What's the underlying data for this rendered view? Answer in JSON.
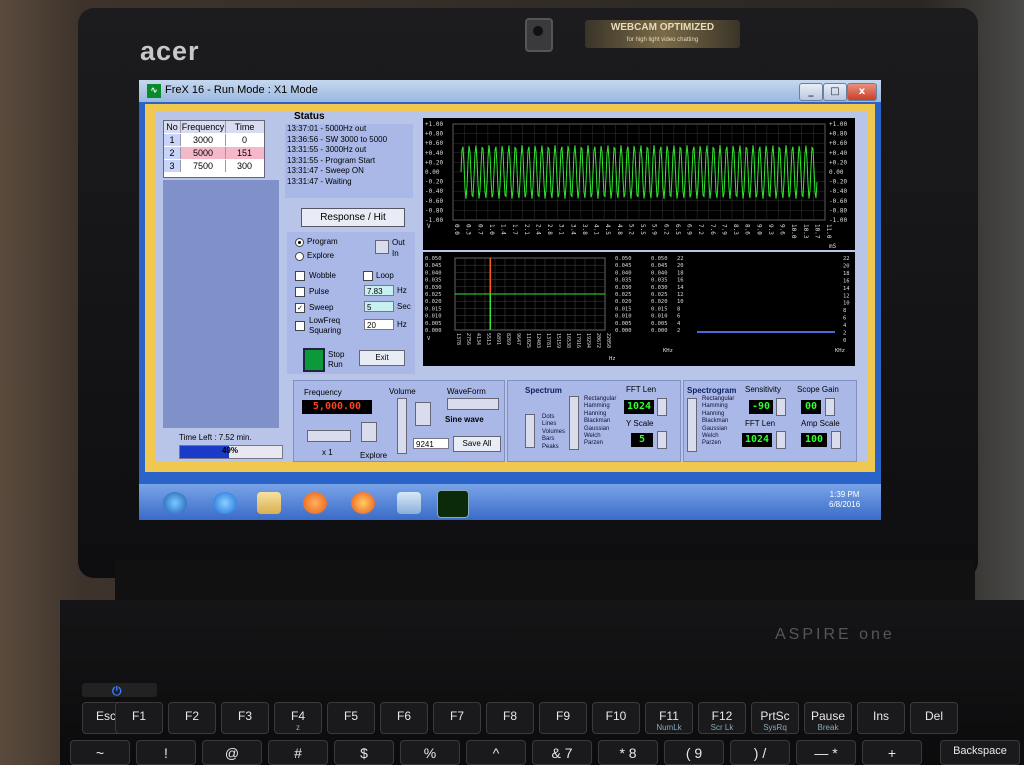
{
  "laptop": {
    "brand": "acer",
    "webcam_sticker": "WEBCAM OPTIMIZED",
    "webcam_sticker_sub": "for high light video chatting",
    "model": "ASPIRE one"
  },
  "keyboard": {
    "row1": [
      {
        "label": "Esc",
        "sub": ""
      },
      {
        "label": "F1",
        "sub": ""
      },
      {
        "label": "F2",
        "sub": ""
      },
      {
        "label": "F3",
        "sub": ""
      },
      {
        "label": "F4",
        "sub": "z"
      },
      {
        "label": "F5",
        "sub": ""
      },
      {
        "label": "F6",
        "sub": ""
      },
      {
        "label": "F7",
        "sub": ""
      },
      {
        "label": "F8",
        "sub": ""
      },
      {
        "label": "F9",
        "sub": ""
      },
      {
        "label": "F10",
        "sub": ""
      },
      {
        "label": "F11",
        "sub": "NumLk"
      },
      {
        "label": "F12",
        "sub": "Scr Lk"
      },
      {
        "label": "PrtSc",
        "sub": "SysRq"
      },
      {
        "label": "Pause",
        "sub": "Break"
      },
      {
        "label": "Ins",
        "sub": ""
      },
      {
        "label": "Del",
        "sub": ""
      }
    ],
    "row2": [
      "~",
      "!",
      "@",
      "#",
      "$",
      "%",
      "^",
      "&  7",
      "*  8",
      "(  9",
      ")  /",
      "—  *",
      "+",
      "Backspace"
    ]
  },
  "window": {
    "title": "FreX 16 - Run Mode :  X1 Mode",
    "icon": "waveform-app-icon",
    "controls": [
      "_",
      "□",
      "x"
    ]
  },
  "freq_table": {
    "headers": [
      "No",
      "Frequency",
      "Time"
    ],
    "rows": [
      {
        "no": "1",
        "frequency": "3000",
        "time": "0",
        "highlight": false
      },
      {
        "no": "2",
        "frequency": "5000",
        "time": "151",
        "highlight": true
      },
      {
        "no": "3",
        "frequency": "7500",
        "time": "300",
        "highlight": false
      }
    ]
  },
  "time_left": "Time Left : 7.52 min.",
  "progress": {
    "value": 0.49,
    "label": "49%"
  },
  "status": {
    "title": "Status",
    "lines": [
      "13:37:01 -  5000Hz out",
      "13:36:56 - SW  3000 to 5000",
      "13:31:55 -  3000Hz out",
      "13:31:55 - Program Start",
      "13:31:47 - Sweep ON",
      "13:31:47 - Waiting"
    ]
  },
  "response_button": "Response / Hit",
  "mode": {
    "program": "Program",
    "explore": "Explore",
    "out": "Out",
    "in": "In",
    "selected": "Program"
  },
  "options": {
    "wobble": {
      "label": "Wobble",
      "checked": false
    },
    "loop": {
      "label": "Loop",
      "checked": false
    },
    "pulse": {
      "label": "Pulse",
      "checked": false,
      "value": "7.83",
      "unit": "Hz"
    },
    "sweep": {
      "label": "Sweep",
      "checked": true,
      "value": "5",
      "unit": "Sec"
    },
    "lowfreq": {
      "label": "LowFreq",
      "label2": "Squaring",
      "checked": false,
      "value": "20",
      "unit": "Hz"
    }
  },
  "stop_run": {
    "stop": "Stop",
    "run": "Run"
  },
  "exit_button": "Exit",
  "scope_top": {
    "y_ticks": [
      "+1.00",
      "+0.80",
      "+0.60",
      "+0.40",
      "+0.20",
      "0.00",
      "-0.20",
      "-0.40",
      "-0.60",
      "-0.80",
      "-1.00"
    ],
    "x_ticks": [
      "0.0",
      "0.3",
      "0.7",
      "1.0",
      "1.4",
      "1.7",
      "2.1",
      "2.4",
      "2.8",
      "3.1",
      "3.4",
      "3.8",
      "4.1",
      "4.5",
      "4.8",
      "5.2",
      "5.5",
      "5.9",
      "6.2",
      "6.5",
      "6.9",
      "7.2",
      "7.6",
      "7.9",
      "8.3",
      "8.6",
      "9.0",
      "9.3",
      "9.6",
      "10.0",
      "10.3",
      "10.7",
      "11.0"
    ],
    "x_unit": "mS",
    "y_unit": "V",
    "trace_color": "#30e830"
  },
  "spectrum_plot": {
    "y_ticks": [
      "0.050",
      "0.045",
      "0.040",
      "0.035",
      "0.030",
      "0.025",
      "0.020",
      "0.015",
      "0.010",
      "0.005",
      "0.000"
    ],
    "x_ticks": [
      "1378",
      "2756",
      "4134",
      "5513",
      "6891",
      "8269",
      "9647",
      "11025",
      "12403",
      "13781",
      "15159",
      "16538",
      "17916",
      "19294",
      "20672",
      "22050"
    ],
    "x_unit": "Hz",
    "y_unit": "V"
  },
  "spectrogram_plot": {
    "left_ticks": [
      "0.050",
      "0.045",
      "0.040",
      "0.035",
      "0.030",
      "0.025",
      "0.020",
      "0.015",
      "0.010",
      "0.005",
      "0.000"
    ],
    "mid_ticks": [
      "22",
      "20",
      "18",
      "16",
      "14",
      "12",
      "10",
      "8",
      "6",
      "4",
      "2"
    ],
    "right_ticks": [
      "22",
      "20",
      "18",
      "16",
      "14",
      "12",
      "10",
      "8",
      "6",
      "4",
      "2",
      "0"
    ],
    "unit": "KHz"
  },
  "frequency_panel": {
    "label": "Frequency",
    "value": "5,000.00",
    "multiplier": "x 1",
    "explore": "Explore"
  },
  "volume_label": "Volume",
  "waveform": {
    "label": "WaveForm",
    "name": "Sine wave",
    "field": "9241",
    "save_all": "Save All"
  },
  "spectrum": {
    "title": "Spectrum",
    "modes": [
      "Dots",
      "Lines",
      "Volumes",
      "Bars",
      "Peaks"
    ],
    "windows": [
      "Rectangular",
      "Hamming",
      "Hanning",
      "Blackman",
      "Gaussian",
      "Welch",
      "Parzen"
    ],
    "fft_len_label": "FFT Len",
    "fft_len": "1024",
    "y_scale_label": "Y Scale",
    "y_scale": "5"
  },
  "spectrogram": {
    "title": "Spectrogram",
    "windows": [
      "Rectangular",
      "Hamming",
      "Hanning",
      "Blackman",
      "Gaussian",
      "Welch",
      "Parzen"
    ],
    "sensitivity_label": "Sensitivity",
    "sensitivity": "-90",
    "scope_gain_label": "Scope Gain",
    "scope_gain": "00",
    "fft_len_label": "FFT Len",
    "fft_len": "1024",
    "amp_scale_label": "Amp Scale",
    "amp_scale": "100"
  },
  "taskbar": {
    "apps": [
      "start-orb-icon",
      "internet-explorer-icon",
      "file-explorer-icon",
      "media-player-icon",
      "firefox-icon",
      "generic-app-icon",
      "frex-waveform-icon"
    ],
    "time": "1:39 PM",
    "date": "6/8/2016"
  }
}
